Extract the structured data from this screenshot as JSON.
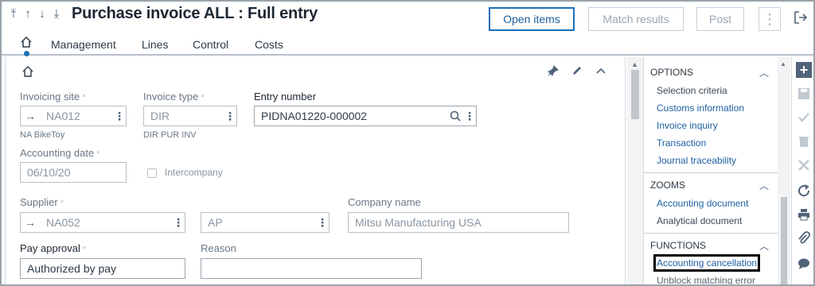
{
  "header": {
    "title": "Purchase invoice ALL : Full entry",
    "nav_arrows": [
      "first-icon",
      "up-icon",
      "down-icon",
      "last-icon"
    ],
    "buttons": {
      "open_items": "Open items",
      "match_results": "Match results",
      "post": "Post",
      "more": "⋮"
    }
  },
  "tabs": [
    "Management",
    "Lines",
    "Control",
    "Costs"
  ],
  "form": {
    "invoicing_site": {
      "label": "Invoicing site",
      "value": "NA012",
      "sub": "NA BikeToy"
    },
    "invoice_type": {
      "label": "Invoice type",
      "value": "DIR",
      "sub": "DIR PUR INV"
    },
    "entry_number": {
      "label": "Entry number",
      "value": "PIDNA01220-000002"
    },
    "accounting_date": {
      "label": "Accounting date",
      "value": "06/10/20"
    },
    "intercompany": {
      "label": "Intercompany",
      "checked": false
    },
    "supplier": {
      "label": "Supplier",
      "value": "NA052"
    },
    "supplier_type": {
      "value": "AP"
    },
    "company_name": {
      "label": "Company name",
      "value": "Mitsu Manufacturing USA"
    },
    "pay_approval": {
      "label": "Pay approval",
      "value": "Authorized by pay"
    },
    "reason": {
      "label": "Reason",
      "value": ""
    },
    "required_mark": "*"
  },
  "side": {
    "options": {
      "title": "OPTIONS",
      "items": [
        "Selection criteria",
        "Customs information",
        "Invoice inquiry",
        "Transaction",
        "Journal traceability"
      ]
    },
    "zooms": {
      "title": "ZOOMS",
      "items": [
        "Accounting document",
        "Analytical document"
      ]
    },
    "functions": {
      "title": "FUNCTIONS",
      "items": [
        "Accounting cancellation",
        "Unblock matching error"
      ]
    }
  },
  "colors": {
    "accent": "#1c6fb7",
    "link": "#1c5e9e",
    "toolbar_icon": "#50637a"
  }
}
